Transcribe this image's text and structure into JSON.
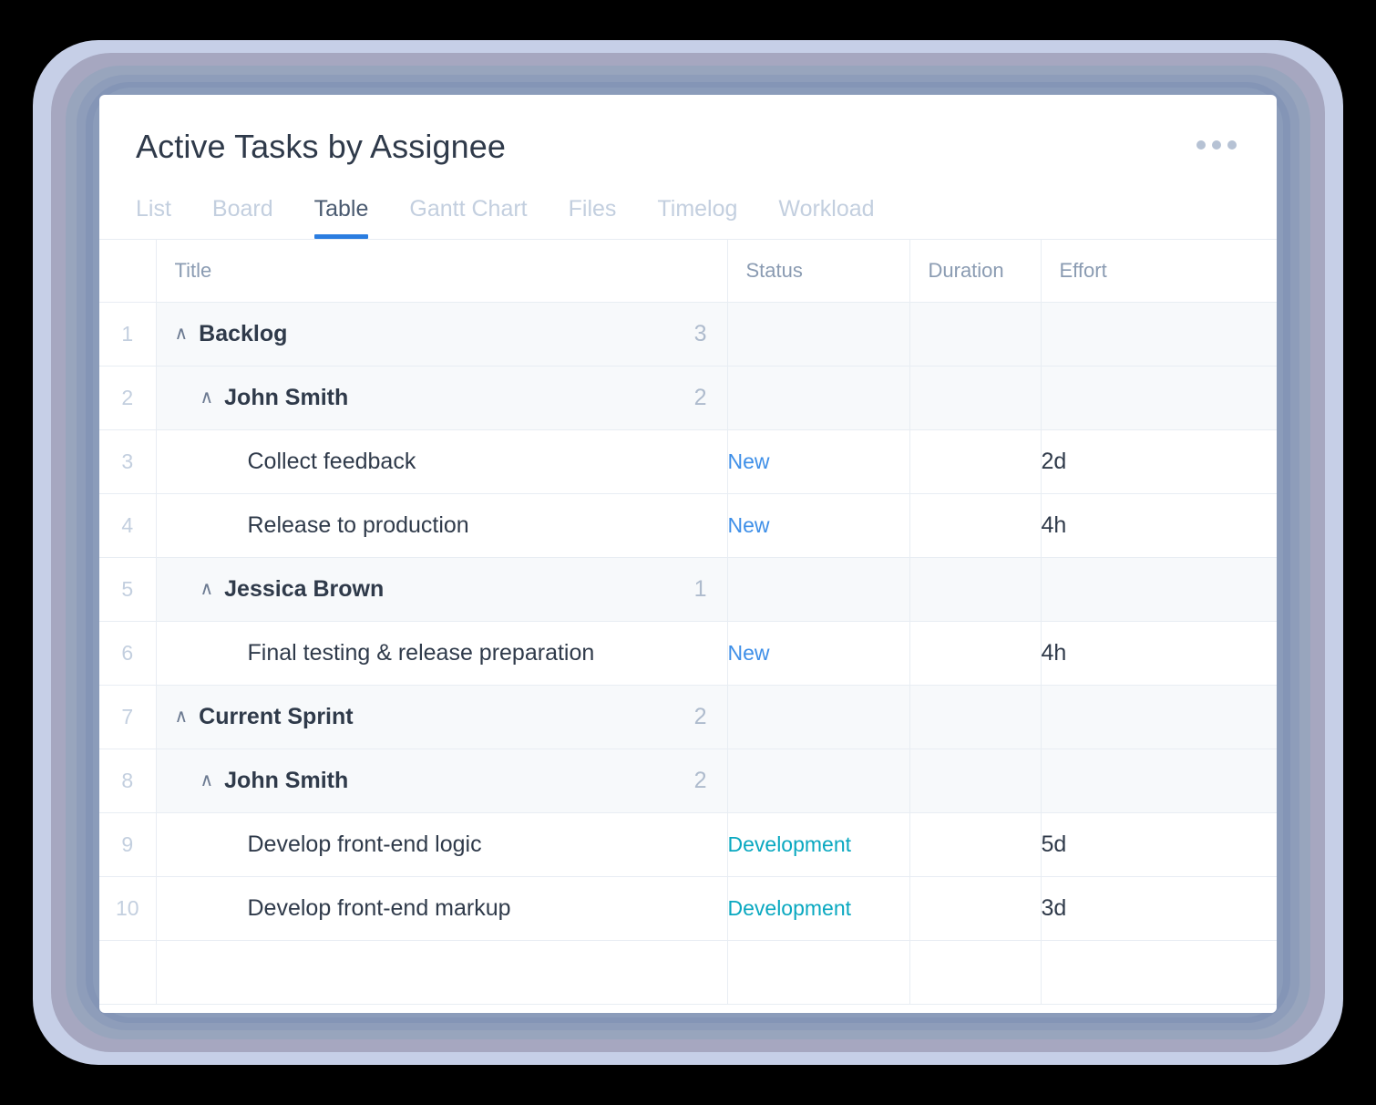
{
  "header": {
    "title": "Active Tasks by Assignee",
    "more_menu_label": "More options"
  },
  "tabs": [
    {
      "label": "List",
      "active": false
    },
    {
      "label": "Board",
      "active": false
    },
    {
      "label": "Table",
      "active": true
    },
    {
      "label": "Gantt Chart",
      "active": false
    },
    {
      "label": "Files",
      "active": false
    },
    {
      "label": "Timelog",
      "active": false
    },
    {
      "label": "Workload",
      "active": false
    }
  ],
  "table": {
    "columns": [
      "",
      "Title",
      "Status",
      "Duration",
      "Effort"
    ],
    "caret_glyph": "∧",
    "rows": [
      {
        "num": "1",
        "level": 0,
        "type": "group",
        "title": "Backlog",
        "count": "3",
        "status": "",
        "status_kind": "",
        "duration": "",
        "effort": ""
      },
      {
        "num": "2",
        "level": 1,
        "type": "group",
        "title": "John Smith",
        "count": "2",
        "status": "",
        "status_kind": "",
        "duration": "",
        "effort": ""
      },
      {
        "num": "3",
        "level": 2,
        "type": "task",
        "title": "Collect feedback",
        "count": "",
        "status": "New",
        "status_kind": "new",
        "duration": "",
        "effort": "2d"
      },
      {
        "num": "4",
        "level": 2,
        "type": "task",
        "title": "Release to production",
        "count": "",
        "status": "New",
        "status_kind": "new",
        "duration": "",
        "effort": "4h"
      },
      {
        "num": "5",
        "level": 1,
        "type": "group",
        "title": "Jessica Brown",
        "count": "1",
        "status": "",
        "status_kind": "",
        "duration": "",
        "effort": ""
      },
      {
        "num": "6",
        "level": 2,
        "type": "task",
        "title": "Final testing & release preparation",
        "count": "",
        "status": "New",
        "status_kind": "new",
        "duration": "",
        "effort": "4h"
      },
      {
        "num": "7",
        "level": 0,
        "type": "group",
        "title": "Current Sprint",
        "count": "2",
        "status": "",
        "status_kind": "",
        "duration": "",
        "effort": ""
      },
      {
        "num": "8",
        "level": 1,
        "type": "group",
        "title": "John Smith",
        "count": "2",
        "status": "",
        "status_kind": "",
        "duration": "",
        "effort": ""
      },
      {
        "num": "9",
        "level": 2,
        "type": "task",
        "title": "Develop front-end logic",
        "count": "",
        "status": "Development",
        "status_kind": "dev",
        "duration": "",
        "effort": "5d"
      },
      {
        "num": "10",
        "level": 2,
        "type": "task",
        "title": "Develop front-end markup",
        "count": "",
        "status": "Development",
        "status_kind": "dev",
        "duration": "",
        "effort": "3d"
      },
      {
        "num": "",
        "level": 2,
        "type": "blank",
        "title": "",
        "count": "",
        "status": "",
        "status_kind": "",
        "duration": "",
        "effort": ""
      }
    ]
  },
  "colors": {
    "accent_tab_underline": "#2b7de0",
    "status_new": "#3e8fe8",
    "status_development": "#09a8c0",
    "grid_line": "#e8edf3",
    "group_row_bg": "#f7f9fb",
    "muted_text": "#c3cfdf",
    "frame_outer": "#c6cfe7",
    "frame_mid": "#a6a7c0",
    "frame_inner": "#8b9cba"
  }
}
